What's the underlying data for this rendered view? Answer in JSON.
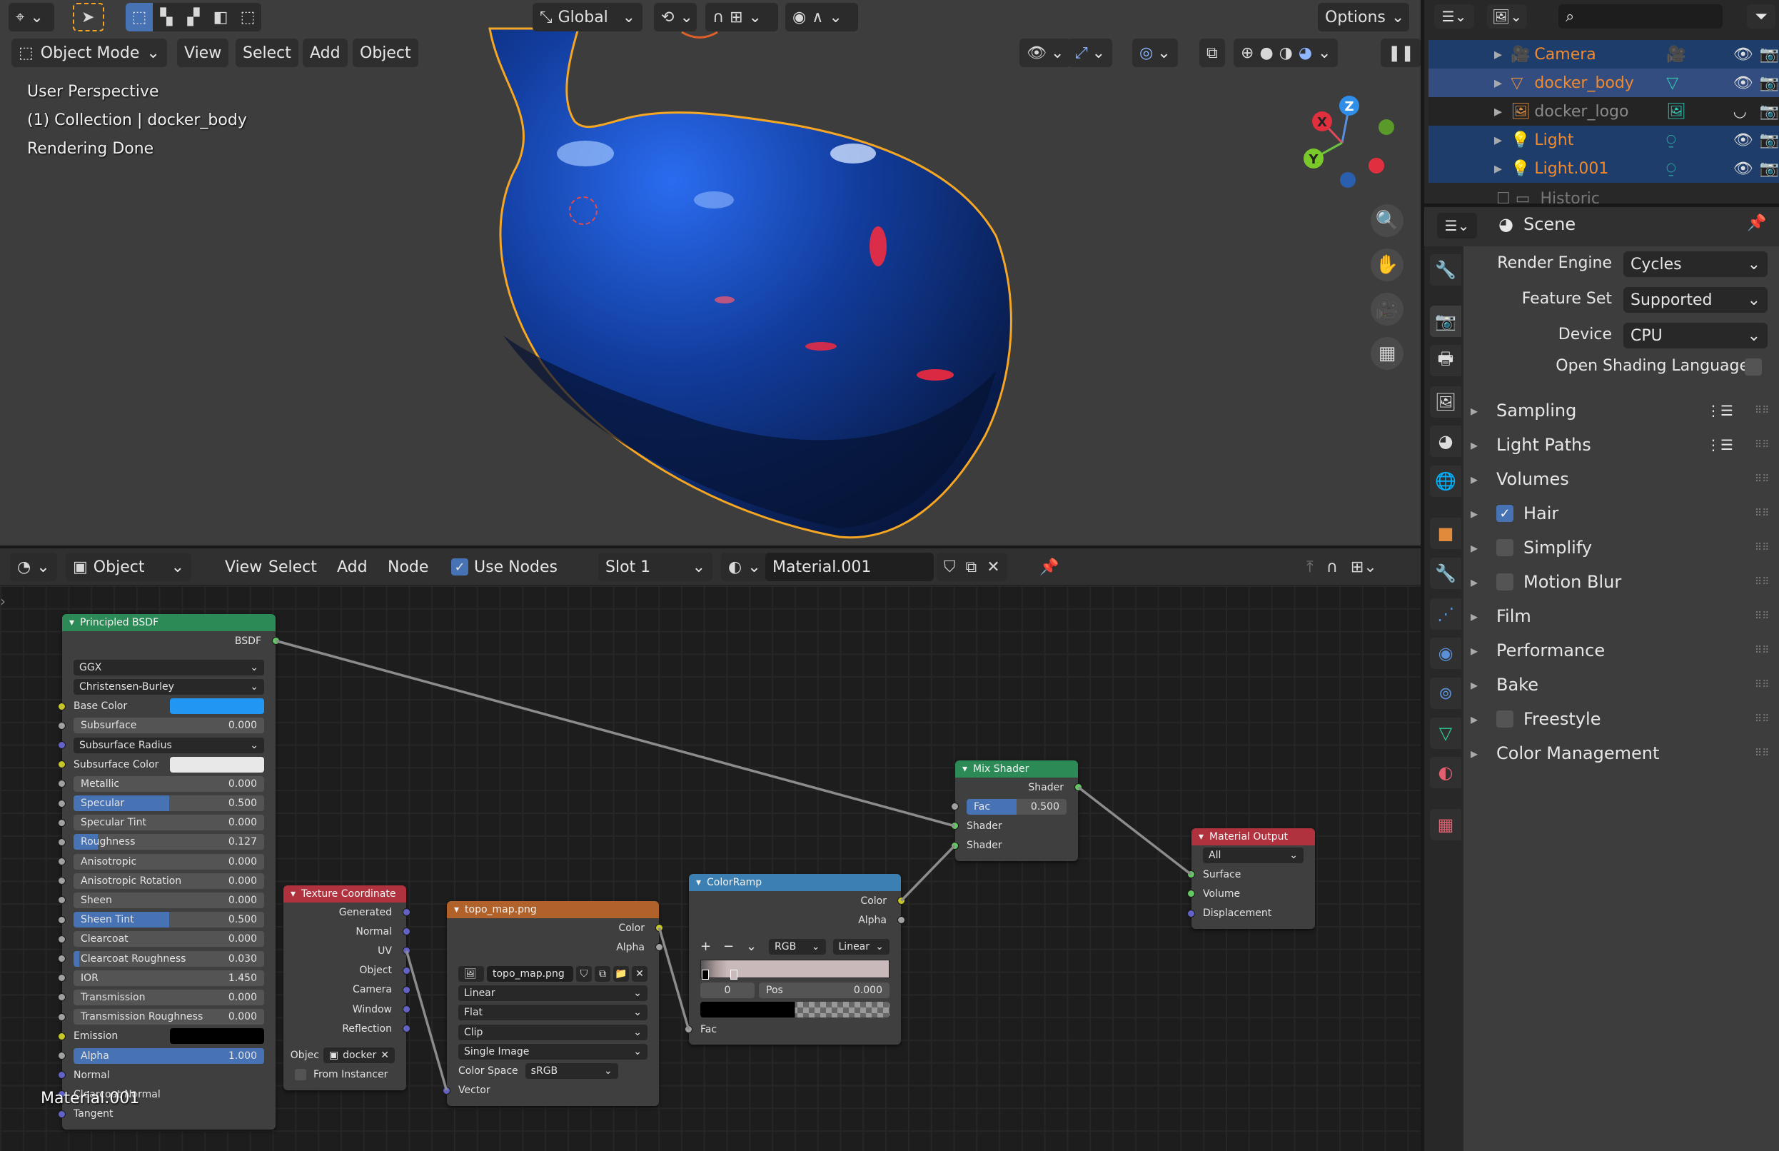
{
  "viewport": {
    "header": {
      "editor_type_icon": "globe-editor-icon",
      "transform_orientation": "Global",
      "options_label": "Options",
      "mode": "Object Mode",
      "menus": [
        "View",
        "Select",
        "Add",
        "Object"
      ]
    },
    "overlay": {
      "perspective": "User Perspective",
      "collection": "(1) Collection | docker_body",
      "status": "Rendering Done"
    },
    "gizmo": {
      "x": "X",
      "y": "Y",
      "z": "Z"
    },
    "colors": {
      "selection_outline": "#f5a623",
      "object_base": "#1f6fe0"
    }
  },
  "node_editor": {
    "header": {
      "object_dropdown": "Object",
      "menus": [
        "View",
        "Select",
        "Add",
        "Node"
      ],
      "use_nodes_label": "Use Nodes",
      "use_nodes_checked": true,
      "slot": "Slot 1",
      "material_name": "Material.001"
    },
    "overlay_material": "Material.001",
    "socket_colors": {
      "gray": "#a1a1a1",
      "yellow": "#c7c729",
      "blue": "#6363c7",
      "green": "#63c763"
    },
    "nodes": [
      {
        "key": "bsdf",
        "title": "Principled BSDF",
        "color": "#2b8a56",
        "rows": [
          {
            "type": "out",
            "label": "BSDF",
            "socket": "green"
          },
          {
            "type": "gap"
          },
          {
            "type": "dropdown",
            "label": "GGX"
          },
          {
            "type": "dropdown",
            "label": "Christensen-Burley"
          },
          {
            "type": "color",
            "label": "Base Color",
            "socket": "yellow",
            "swatch": "#2196f3"
          },
          {
            "type": "slider",
            "label": "Subsurface",
            "value": "0.000",
            "fill": 0,
            "socket": "gray"
          },
          {
            "type": "dropdown",
            "label": "Subsurface Radius",
            "socket": "blue"
          },
          {
            "type": "color",
            "label": "Subsurface Color",
            "socket": "yellow",
            "swatch": "#e8e8e8"
          },
          {
            "type": "slider",
            "label": "Metallic",
            "value": "0.000",
            "fill": 0,
            "socket": "gray"
          },
          {
            "type": "slider",
            "label": "Specular",
            "value": "0.500",
            "fill": 0.5,
            "socket": "gray"
          },
          {
            "type": "slider",
            "label": "Specular Tint",
            "value": "0.000",
            "fill": 0,
            "socket": "gray"
          },
          {
            "type": "slider",
            "label": "Roughness",
            "value": "0.127",
            "fill": 0.127,
            "socket": "gray"
          },
          {
            "type": "slider",
            "label": "Anisotropic",
            "value": "0.000",
            "fill": 0,
            "socket": "gray"
          },
          {
            "type": "slider",
            "label": "Anisotropic Rotation",
            "value": "0.000",
            "fill": 0,
            "socket": "gray"
          },
          {
            "type": "slider",
            "label": "Sheen",
            "value": "0.000",
            "fill": 0,
            "socket": "gray"
          },
          {
            "type": "slider",
            "label": "Sheen Tint",
            "value": "0.500",
            "fill": 0.5,
            "socket": "gray"
          },
          {
            "type": "slider",
            "label": "Clearcoat",
            "value": "0.000",
            "fill": 0,
            "socket": "gray"
          },
          {
            "type": "slider",
            "label": "Clearcoat Roughness",
            "value": "0.030",
            "fill": 0.03,
            "socket": "gray"
          },
          {
            "type": "slider",
            "label": "IOR",
            "value": "1.450",
            "fill": 0,
            "socket": "gray"
          },
          {
            "type": "slider",
            "label": "Transmission",
            "value": "0.000",
            "fill": 0,
            "socket": "gray"
          },
          {
            "type": "slider",
            "label": "Transmission Roughness",
            "value": "0.000",
            "fill": 0,
            "socket": "gray"
          },
          {
            "type": "color",
            "label": "Emission",
            "socket": "yellow",
            "swatch": "#000000"
          },
          {
            "type": "slider",
            "label": "Alpha",
            "value": "1.000",
            "fill": 1,
            "socket": "gray"
          },
          {
            "type": "in",
            "label": "Normal",
            "socket": "blue"
          },
          {
            "type": "in",
            "label": "Clearcoat Normal",
            "socket": "blue"
          },
          {
            "type": "in",
            "label": "Tangent",
            "socket": "blue"
          }
        ]
      },
      {
        "key": "texcoord",
        "title": "Texture Coordinate",
        "color": "#b0323e",
        "rows": [
          {
            "type": "out",
            "label": "Generated",
            "socket": "blue"
          },
          {
            "type": "out",
            "label": "Normal",
            "socket": "blue"
          },
          {
            "type": "out",
            "label": "UV",
            "socket": "blue"
          },
          {
            "type": "out",
            "label": "Object",
            "socket": "blue"
          },
          {
            "type": "out",
            "label": "Camera",
            "socket": "blue"
          },
          {
            "type": "out",
            "label": "Window",
            "socket": "blue"
          },
          {
            "type": "out",
            "label": "Reflection",
            "socket": "blue"
          },
          {
            "type": "gap"
          },
          {
            "type": "object",
            "label": "Objec",
            "value": "docker"
          },
          {
            "type": "checkbox",
            "label": "From Instancer",
            "checked": false
          }
        ]
      },
      {
        "key": "topo",
        "title": "topo_map.png",
        "color": "#b0622a",
        "rows": [
          {
            "type": "out",
            "label": "Color",
            "socket": "yellow"
          },
          {
            "type": "out",
            "label": "Alpha",
            "socket": "gray"
          },
          {
            "type": "gap"
          },
          {
            "type": "image",
            "label": "topo_map.png"
          },
          {
            "type": "dropdown",
            "label": "Linear"
          },
          {
            "type": "dropdown",
            "label": "Flat"
          },
          {
            "type": "dropdown",
            "label": "Clip"
          },
          {
            "type": "dropdown",
            "label": "Single Image"
          },
          {
            "type": "labeled",
            "label": "Color Space",
            "value": "sRGB"
          },
          {
            "type": "in",
            "label": "Vector",
            "socket": "blue"
          }
        ]
      },
      {
        "key": "ramp",
        "title": "ColorRamp",
        "color": "#3b7fb3",
        "rows": [
          {
            "type": "out",
            "label": "Color",
            "socket": "yellow"
          },
          {
            "type": "out",
            "label": "Alpha",
            "socket": "gray"
          },
          {
            "type": "gap"
          },
          {
            "type": "ramptools",
            "label": "RGB",
            "value": "Linear"
          },
          {
            "type": "rampbar"
          },
          {
            "type": "ramppos",
            "label": "0",
            "pos_label": "Pos",
            "value": "0.000"
          },
          {
            "type": "rampswatch"
          },
          {
            "type": "in",
            "label": "Fac",
            "socket": "gray"
          }
        ]
      },
      {
        "key": "mix",
        "title": "Mix Shader",
        "color": "#2b8a56",
        "rows": [
          {
            "type": "out",
            "label": "Shader",
            "socket": "green"
          },
          {
            "type": "slider",
            "label": "Fac",
            "value": "0.500",
            "fill": 0.5,
            "socket": "gray"
          },
          {
            "type": "in",
            "label": "Shader",
            "socket": "green"
          },
          {
            "type": "in",
            "label": "Shader",
            "socket": "green"
          }
        ]
      },
      {
        "key": "output",
        "title": "Material Output",
        "color": "#b0323e",
        "rows": [
          {
            "type": "dropdown",
            "label": "All"
          },
          {
            "type": "in",
            "label": "Surface",
            "socket": "green"
          },
          {
            "type": "in",
            "label": "Volume",
            "socket": "green"
          },
          {
            "type": "in",
            "label": "Displacement",
            "socket": "blue"
          }
        ]
      }
    ]
  },
  "outliner": {
    "items": [
      {
        "name": "Camera",
        "icon": "camera-icon",
        "data_icon": "camera-data-icon",
        "visible": true,
        "selected": true,
        "active": false,
        "color": "#f08a2c"
      },
      {
        "name": "docker_body",
        "icon": "mesh-icon",
        "data_icon": "mesh-data-icon",
        "visible": true,
        "selected": true,
        "active": true,
        "color": "#f08a2c"
      },
      {
        "name": "docker_logo",
        "icon": "image-icon",
        "data_icon": "image-data-icon",
        "visible": false,
        "selected": false,
        "active": false,
        "color": "#8a8a8a"
      },
      {
        "name": "Light",
        "icon": "light-icon",
        "data_icon": "light-data-icon",
        "visible": true,
        "selected": true,
        "active": false,
        "color": "#f08a2c"
      },
      {
        "name": "Light.001",
        "icon": "light-icon",
        "data_icon": "light-data-icon",
        "visible": true,
        "selected": true,
        "active": false,
        "color": "#f08a2c"
      }
    ],
    "cut_item": "Historic"
  },
  "properties": {
    "context": "Scene",
    "fields": [
      {
        "label": "Render Engine",
        "value": "Cycles"
      },
      {
        "label": "Feature Set",
        "value": "Supported"
      },
      {
        "label": "Device",
        "value": "CPU"
      }
    ],
    "osl_label": "Open Shading Language",
    "osl_checked": false,
    "panels": [
      {
        "label": "Sampling",
        "checkbox": null,
        "presets": true
      },
      {
        "label": "Light Paths",
        "checkbox": null,
        "presets": true
      },
      {
        "label": "Volumes",
        "checkbox": null,
        "presets": false
      },
      {
        "label": "Hair",
        "checkbox": true,
        "presets": false
      },
      {
        "label": "Simplify",
        "checkbox": false,
        "presets": false
      },
      {
        "label": "Motion Blur",
        "checkbox": false,
        "presets": false
      },
      {
        "label": "Film",
        "checkbox": null,
        "presets": false
      },
      {
        "label": "Performance",
        "checkbox": null,
        "presets": false
      },
      {
        "label": "Bake",
        "checkbox": null,
        "presets": false
      },
      {
        "label": "Freestyle",
        "checkbox": false,
        "presets": false
      },
      {
        "label": "Color Management",
        "checkbox": null,
        "presets": false
      }
    ],
    "tabs": [
      {
        "name": "tool-tab",
        "glyph": "🔧",
        "color": "#dddddd"
      },
      {
        "name": "render-tab",
        "glyph": "📷",
        "color": "#dddddd",
        "active": true
      },
      {
        "name": "output-tab",
        "glyph": "🖶",
        "color": "#dddddd"
      },
      {
        "name": "view-layer-tab",
        "glyph": "🖼",
        "color": "#dddddd"
      },
      {
        "name": "scene-tab",
        "glyph": "◕",
        "color": "#dddddd"
      },
      {
        "name": "world-tab",
        "glyph": "🌐",
        "color": "#e06070"
      },
      {
        "name": "object-tab",
        "glyph": "■",
        "color": "#e08a3c"
      },
      {
        "name": "modifier-tab",
        "glyph": "🔧",
        "color": "#5b8fd6"
      },
      {
        "name": "particles-tab",
        "glyph": "⋰",
        "color": "#5b8fd6"
      },
      {
        "name": "physics-tab",
        "glyph": "◉",
        "color": "#5b8fd6"
      },
      {
        "name": "constraints-tab",
        "glyph": "⊚",
        "color": "#5b8fd6"
      },
      {
        "name": "mesh-data-tab",
        "glyph": "▽",
        "color": "#2ecc9a"
      },
      {
        "name": "material-tab",
        "glyph": "◐",
        "color": "#e06070"
      },
      {
        "name": "texture-tab",
        "glyph": "▦",
        "color": "#e06070"
      }
    ]
  }
}
